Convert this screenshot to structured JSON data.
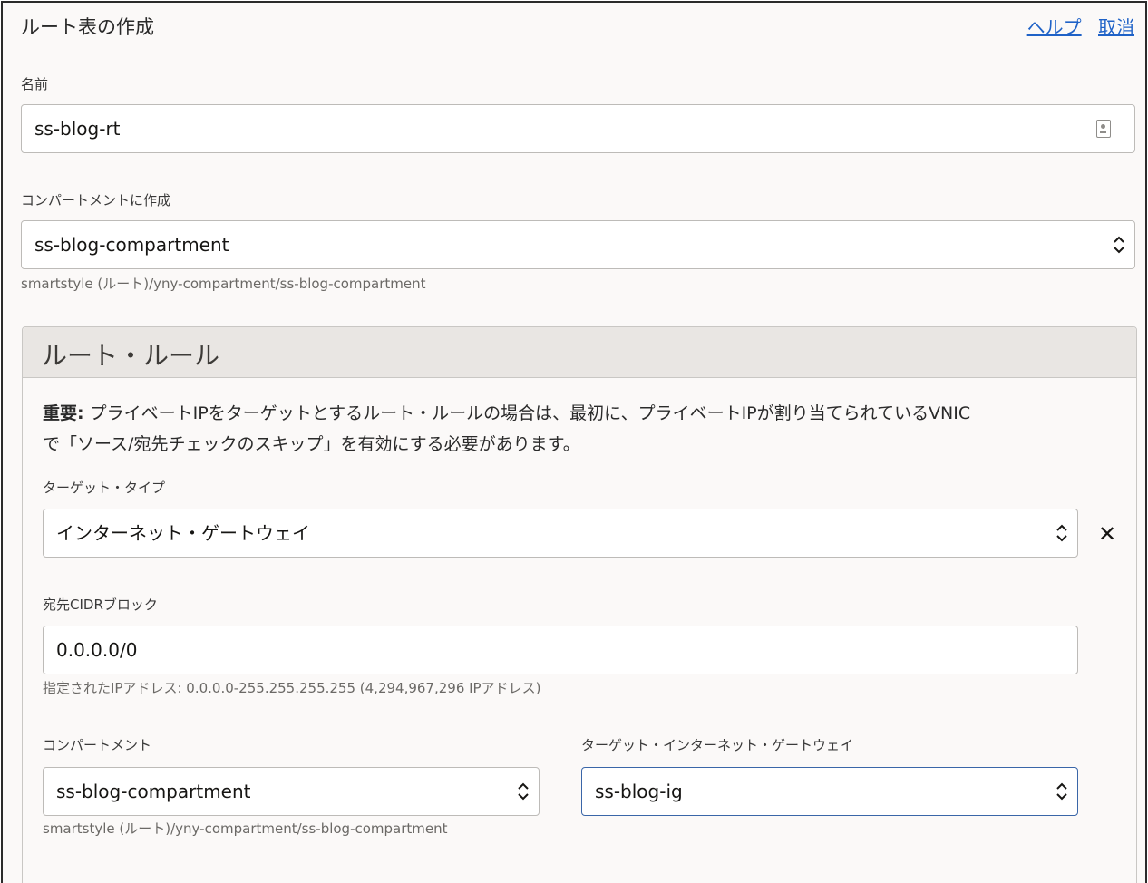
{
  "header": {
    "title": "ルート表の作成",
    "help_link": "ヘルプ",
    "cancel_link": "取消"
  },
  "name_field": {
    "label": "名前",
    "value": "ss-blog-rt"
  },
  "compartment_field": {
    "label": "コンパートメントに作成",
    "value": "ss-blog-compartment",
    "path": "smartstyle (ルート)/yny-compartment/ss-blog-compartment"
  },
  "route_rules": {
    "title": "ルート・ルール",
    "note_bold": "重要:",
    "note_line1": " プライベートIPをターゲットとするルート・ルールの場合は、最初に、プライベートIPが割り当てられているVNIC",
    "note_line2": "で「ソース/宛先チェックのスキップ」を有効にする必要があります。",
    "target_type": {
      "label": "ターゲット・タイプ",
      "value": "インターネット・ゲートウェイ"
    },
    "remove_glyph": "✕",
    "cidr": {
      "label": "宛先CIDRブロック",
      "value": "0.0.0.0/0",
      "hint": "指定されたIPアドレス: 0.0.0.0-255.255.255.255 (4,294,967,296 IPアドレス)"
    },
    "rule_compartment": {
      "label": "コンパートメント",
      "value": "ss-blog-compartment",
      "path": "smartstyle (ルート)/yny-compartment/ss-blog-compartment"
    },
    "target_gateway": {
      "label": "ターゲット・インターネット・ゲートウェイ",
      "value": "ss-blog-ig"
    }
  },
  "colors": {
    "link": "#1f62c7",
    "focus_border": "#3a66a8",
    "panel_header": "#e9e6e3",
    "background": "#fbf9f8"
  },
  "icons": [
    "contact-card-icon",
    "select-arrows-icon",
    "close-icon"
  ]
}
